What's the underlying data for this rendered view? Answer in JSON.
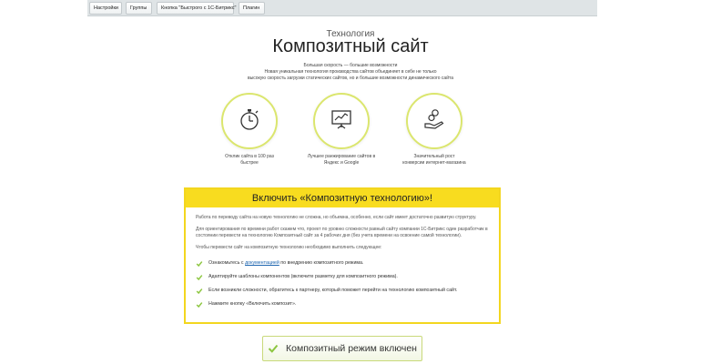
{
  "tabs": [
    {
      "label": "Настройки"
    },
    {
      "label": "Группы"
    },
    {
      "label": "Кнопка \"Быстрого с 1С-Битрикс\""
    },
    {
      "label": "Плагин"
    }
  ],
  "header": {
    "subtitle": "Технология",
    "title": "Композитный сайт",
    "desc_line1": "Большая скорость — большие возможности",
    "desc_line2": "Новая уникальная технология производства сайтов объединяет в себе не только",
    "desc_line3": "высокую скорость загрузки статических сайтов, но и большие возможности динамического сайта"
  },
  "features": [
    {
      "icon": "stopwatch-icon",
      "line1": "Отклик сайта в 100 раз",
      "line2": "быстрее"
    },
    {
      "icon": "chart-board-icon",
      "line1": "Лучшее ранжирование сайтов в",
      "line2": "Яндекс и Google"
    },
    {
      "icon": "hand-coins-icon",
      "line1": "Значительный рост",
      "line2": "конверсии интернет-магазина"
    }
  ],
  "panel": {
    "heading": "Включить «Композитную технологию»!",
    "para1": "Работа по переводу сайта на новую технологию не сложна, но объемна, особенно, если сайт имеет достаточно развитую структуру.",
    "para2": "Для ориентирования по времени работ скажем что, проект по уровню сложности равный сайту компании 1С-Битрикс один разработчик в состоянии перевести на технологию Композитный сайт за 4 рабочих дня (без учета времени на освоение самой технологии).",
    "para3": "Чтобы перевести сайт на композитную технологию необходимо выполнить следующее:",
    "step1_pre": "Ознакомьтесь с",
    "step1_link": "документацией",
    "step1_post": "по внедрению композитного режима.",
    "step2": "Адаптируйте шаблоны компонентов (включите разметку для композитного режима).",
    "step3": "Если возникли сложности, обратитесь к партнеру, который поможет перейти на технологию композитный сайт.",
    "step4": "Нажмите кнопку «Включить композит»."
  },
  "status_button": {
    "label": "Композитный режим включен"
  },
  "colors": {
    "accent": "#f8dc1f",
    "check": "#8cc63f",
    "circle_border": "#dbe66e",
    "link": "#2067b0"
  }
}
